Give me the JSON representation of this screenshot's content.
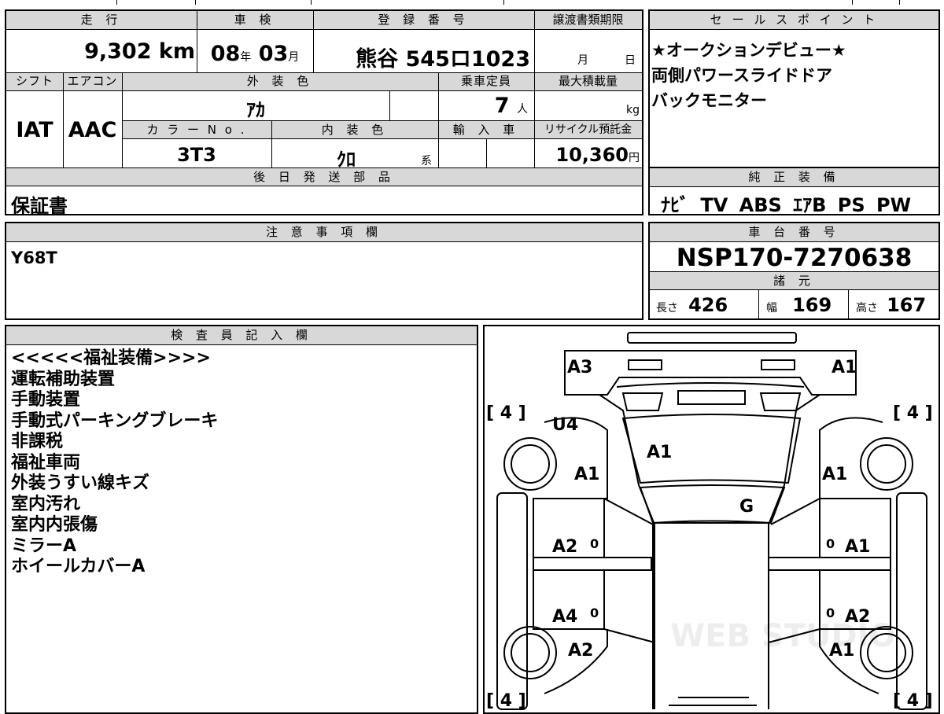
{
  "main": {
    "headers": {
      "mileage": "走 行",
      "inspection": "車 検",
      "registration": "登 録 番 号",
      "deadline": "譲渡書類期限",
      "shift": "シフト",
      "aircon": "エアコン",
      "exterior": "外 装 色",
      "capacity": "乗車定員",
      "maxload": "最大積載量",
      "colorno": "カ ラ ー N o .",
      "interior": "内 装 色",
      "import": "輸 入 車",
      "recycle": "リサイクル預託金",
      "later_parts": "後 日 発 送 部 品"
    },
    "mileage_value": "9,302",
    "mileage_unit": "km",
    "inspection_year": "08",
    "year_unit": "年",
    "inspection_month": "03",
    "month_unit": "月",
    "registration_number": "熊谷 545ロ1023",
    "deadline_month": "月",
    "deadline_day": "日",
    "shift_value": "IAT",
    "aircon_value": "AAC",
    "exterior_color": "ｱｶ",
    "capacity_value": "7",
    "capacity_unit": "人",
    "maxload_unit": "kg",
    "color_no": "3T3",
    "interior_color": "ｸﾛ",
    "interior_suffix": "系",
    "recycle_value": "10,360",
    "recycle_unit": "円",
    "later_parts_value": "保証書"
  },
  "sales": {
    "header": "セ ー ル ス ポ イ ン ト",
    "points": [
      "★オークションデビュー★",
      "両側パワースライドドア",
      "バックモニター"
    ]
  },
  "equipment": {
    "header": "純 正 装 備",
    "items": "ﾅﾋﾞ TV ABS ｴｱB PS PW"
  },
  "notes": {
    "header": "注 意 事 項 欄",
    "text": "Y68T"
  },
  "chassis": {
    "header": "車 台 番 号",
    "number": "NSP170-7270638"
  },
  "specs": {
    "header": "諸 元",
    "length_label": "長さ",
    "length": "426",
    "width_label": "幅",
    "width": "169",
    "height_label": "高さ",
    "height": "167"
  },
  "inspector": {
    "header": "検 査 員 記 入 欄",
    "lines": [
      "<<<<<福祉装備>>>>",
      "運転補助装置",
      "手動装置",
      "手動式パーキングブレーキ",
      "非課税",
      "福祉車両",
      "外装うすい線キズ",
      "室内汚れ",
      "室内内張傷",
      "ミラーA",
      "ホイールカバーA"
    ]
  },
  "diagram": {
    "marks": {
      "a3": "A3",
      "a1_top_right": "A1",
      "u4": "U4",
      "a1_windshield": "A1",
      "a1_left_fender": "A1",
      "a1_right_fender": "A1",
      "g": "G",
      "a2_left_front_door": "A2",
      "a1_right_front_door": "A1",
      "a4_left_rear_door": "A4",
      "a2_right_rear_door": "A2",
      "a2_left_rear": "A2",
      "a1_right_rear": "A1",
      "zero_1": "0",
      "zero_2": "0",
      "zero_3": "0",
      "zero_4": "0"
    },
    "tires": {
      "front_left": "[ 4 ]",
      "front_right": "[ 4 ]",
      "rear_left": "[ 4 ]",
      "rear_right": "[ 4 ]"
    },
    "watermark": "WEB STUDIO"
  }
}
